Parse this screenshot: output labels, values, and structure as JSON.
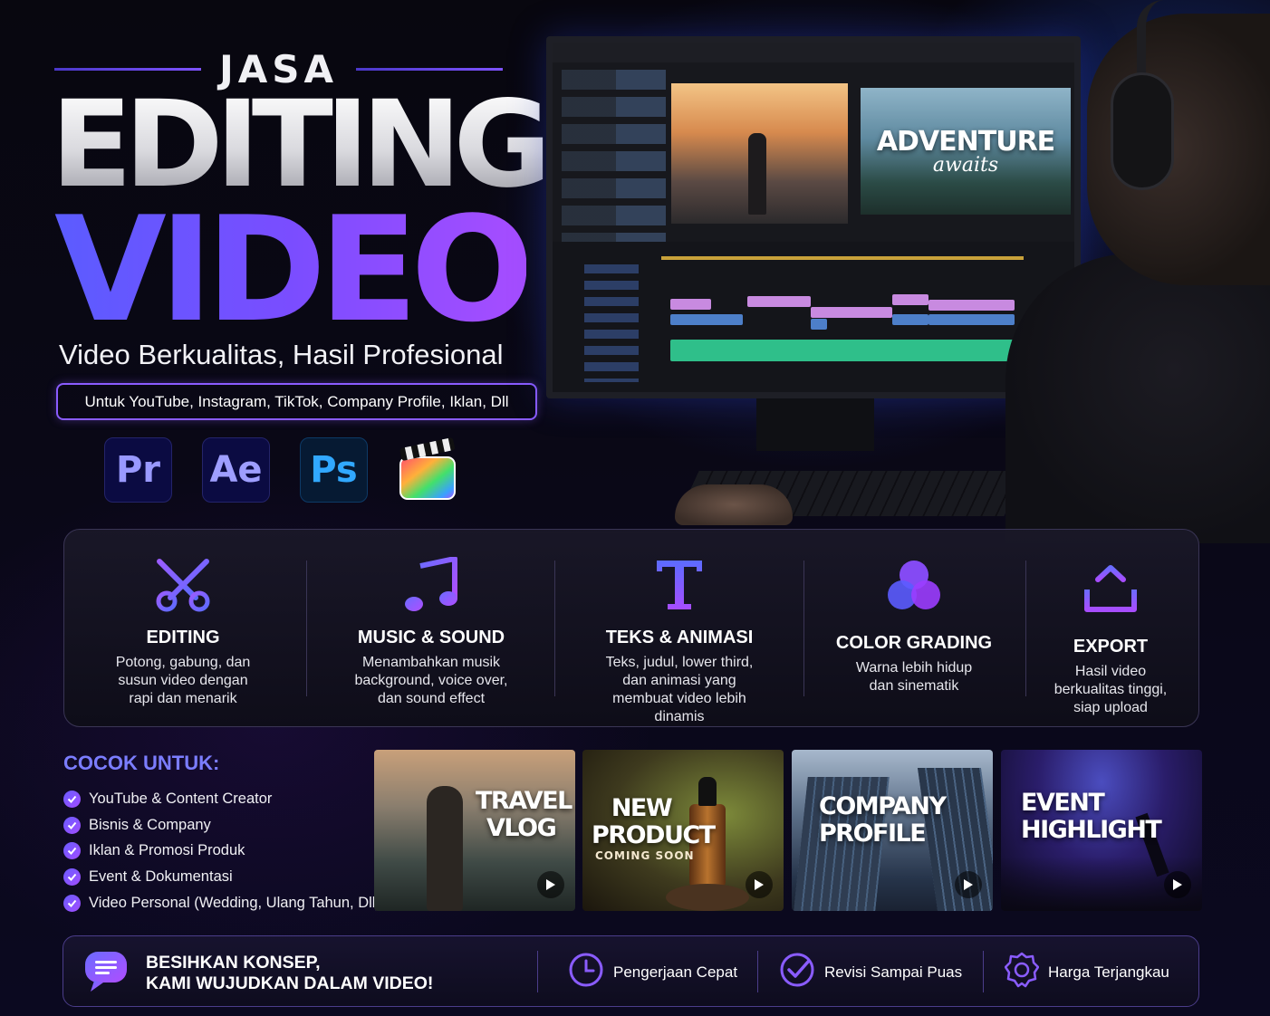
{
  "hero": {
    "jasa": "JASA",
    "editing": "EDITING",
    "video": "VIDEO",
    "tagline": "Video Berkualitas, Hasil Profesional",
    "platforms": "Untuk YouTube, Instagram, TikTok, Company Profile, Iklan, Dll"
  },
  "apps": [
    {
      "label": "Pr",
      "icon": "premiere-pro-icon"
    },
    {
      "label": "Ae",
      "icon": "after-effects-icon"
    },
    {
      "label": "Ps",
      "icon": "photoshop-icon"
    },
    {
      "label": "",
      "icon": "final-cut-pro-icon"
    }
  ],
  "monitor": {
    "program_title": "ADVENTURE",
    "program_subtitle": "awaits"
  },
  "services": [
    {
      "title": "EDITING",
      "desc": [
        "Potong, gabung, dan",
        "susun video dengan",
        "rapi dan menarik"
      ],
      "icon": "scissors-icon"
    },
    {
      "title": "MUSIC & SOUND",
      "desc": [
        "Menambahkan musik",
        "background, voice over,",
        "dan sound effect"
      ],
      "icon": "music-note-icon"
    },
    {
      "title": "TEKS & ANIMASI",
      "desc": [
        "Teks, judul, lower third,",
        "dan animasi yang",
        "membuat video lebih",
        "dinamis"
      ],
      "icon": "text-t-icon"
    },
    {
      "title": "COLOR GRADING",
      "desc": [
        "Warna lebih hidup",
        "dan sinematik"
      ],
      "icon": "color-circles-icon"
    },
    {
      "title": "EXPORT",
      "desc": [
        "Hasil video",
        "berkualitas tinggi,",
        "siap upload"
      ],
      "icon": "upload-icon"
    }
  ],
  "cocok": {
    "title": "COCOK UNTUK:",
    "items": [
      "YouTube & Content Creator",
      "Bisnis & Company",
      "Iklan & Promosi Produk",
      "Event & Dokumentasi",
      "Video Personal (Wedding, Ulang Tahun, Dll)"
    ]
  },
  "thumbnails": [
    {
      "title_1": "TRAVEL",
      "title_2": "VLOG",
      "subtitle": ""
    },
    {
      "title_1": "NEW",
      "title_2": "PRODUCT",
      "subtitle": "COMING SOON"
    },
    {
      "title_1": "COMPANY",
      "title_2": "PROFILE",
      "subtitle": ""
    },
    {
      "title_1": "EVENT",
      "title_2": "HIGHLIGHT",
      "subtitle": ""
    }
  ],
  "footer": {
    "cta_line1": "BESIHKAN KONSEP,",
    "cta_line2": "KAMI WUJUDKAN DALAM VIDEO!",
    "features": [
      {
        "label": "Pengerjaan Cepat",
        "icon": "clock-icon"
      },
      {
        "label": "Revisi Sampai Puas",
        "icon": "check-circle-icon"
      },
      {
        "label": "Harga Terjangkau",
        "icon": "badge-icon"
      }
    ]
  },
  "colors": {
    "accent_purple": "#8a5cff",
    "accent_blue": "#5b5cff",
    "cocok_title": "#7b7dff"
  }
}
